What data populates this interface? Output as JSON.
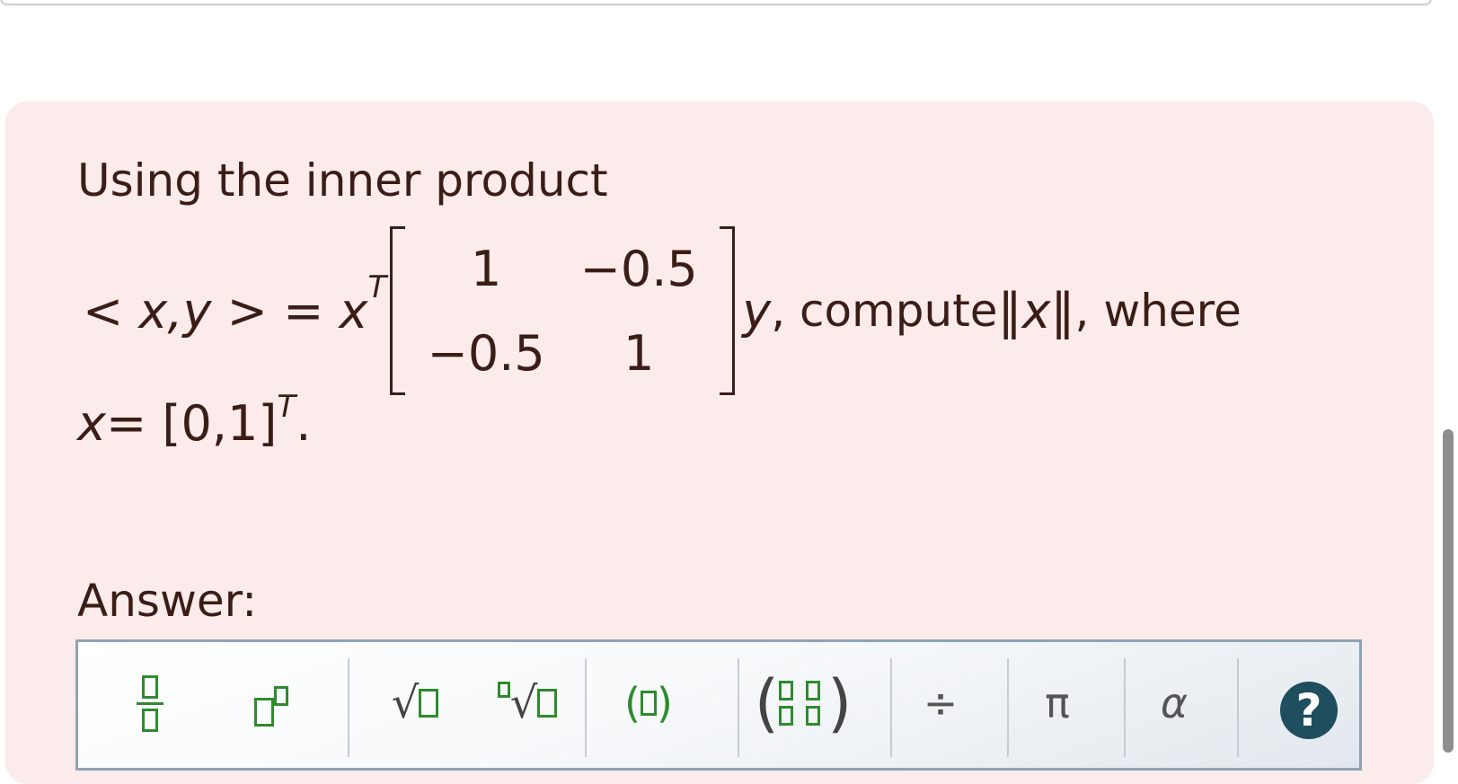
{
  "question": {
    "intro": "Using the inner product",
    "lhs": "< x,y > = x",
    "sup_T": "T",
    "matrix": [
      [
        "1",
        "−0.5"
      ],
      [
        "−0.5",
        "1"
      ]
    ],
    "after_matrix_var": "y",
    "after_matrix_text": ", compute ",
    "norm": "‖x‖",
    "where": ", where",
    "x_def_lhs": "x",
    "x_def_rhs": "= [0,1]",
    "x_def_sup": "T",
    "x_def_end": "."
  },
  "answer": {
    "label": "Answer:"
  },
  "toolbar": {
    "tools": [
      "fraction",
      "superscript",
      "square-root",
      "nth-root",
      "parentheses",
      "matrix",
      "divide",
      "pi",
      "alpha",
      "help"
    ],
    "divide_symbol": "÷",
    "pi_symbol": "π",
    "alpha_symbol": "α",
    "help_symbol": "?",
    "accent_color": "#2e8b2e"
  }
}
